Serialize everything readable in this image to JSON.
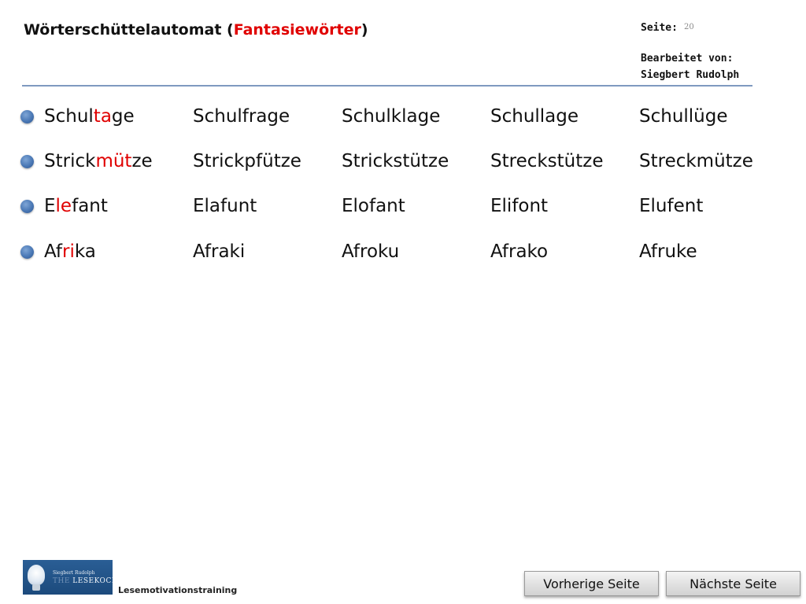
{
  "header": {
    "title_prefix": "Wörterschüttelautomat (",
    "title_accent": "Fantasiewörter",
    "title_suffix": ")",
    "page_label": "Seite:",
    "page_number": "20",
    "edited_label": "Bearbeitet von:",
    "author": "Siegbert Rudolph"
  },
  "rows": [
    {
      "base": {
        "pre": "Schul",
        "hl": "ta",
        "post": "ge"
      },
      "variants": [
        "Schulfrage",
        "Schulklage",
        "Schullage",
        "Schullüge"
      ]
    },
    {
      "base": {
        "pre": "Strick",
        "hl": "müt",
        "post": "ze"
      },
      "variants": [
        "Strickpfütze",
        "Strickstütze",
        "Streckstütze",
        "Streckmütze"
      ]
    },
    {
      "base": {
        "pre": "E",
        "hl": "le",
        "post": "fant"
      },
      "variants": [
        "Elafunt",
        "Elofant",
        "Elifont",
        "Elufent"
      ]
    },
    {
      "base": {
        "pre": "Af",
        "hl": "ri",
        "post": "ka"
      },
      "variants": [
        "Afraki",
        "Afroku",
        "Afrako",
        "Afruke"
      ]
    }
  ],
  "footer": {
    "logo_small": "Siegbert Rudolph",
    "logo_faint": "THE ",
    "logo_big": "LESEKOCH",
    "label": "Lesemotivationstraining",
    "prev_label": "Vorherige Seite",
    "next_label": "Nächste Seite"
  },
  "colors": {
    "accent": "#e00000",
    "rule": "#7f9ac0",
    "bullet": "#4a78b5"
  }
}
